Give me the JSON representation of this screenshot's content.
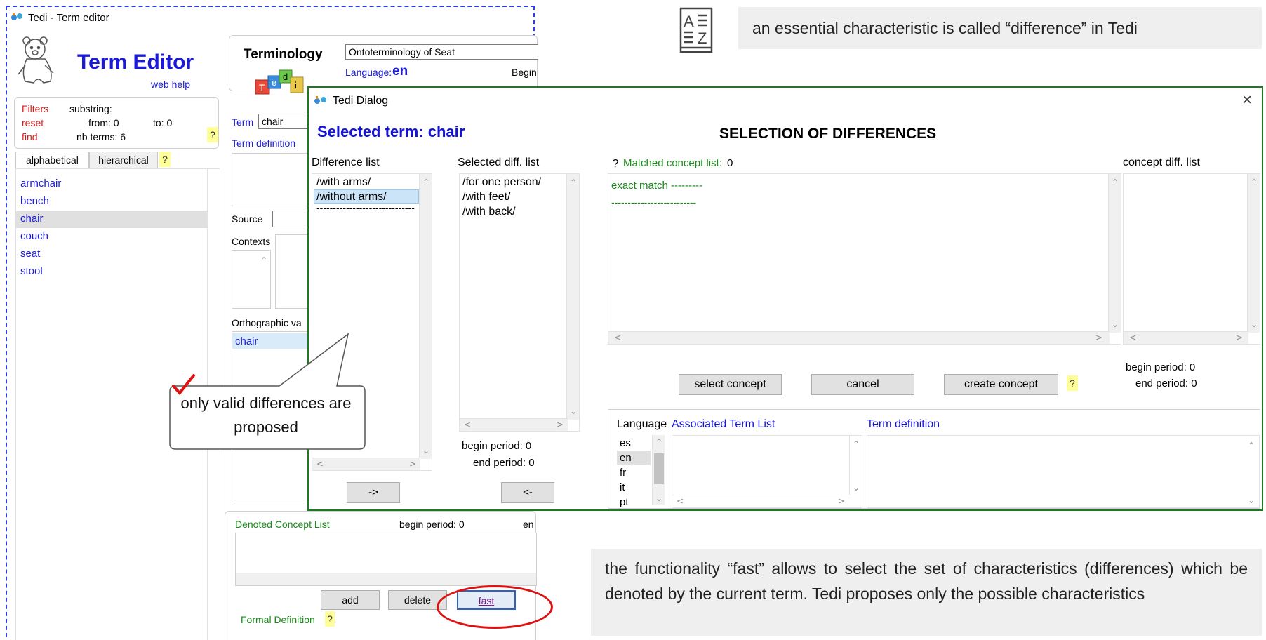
{
  "main_window": {
    "title": "Tedi - Term editor",
    "header_title": "Term Editor",
    "web_help": "web help",
    "filters": {
      "filters_label": "Filters",
      "reset_label": "reset",
      "find_label": "find",
      "substring_label": "substring:",
      "from_label": "from: 0",
      "to_label": "to: 0",
      "nb_terms_label": "nb terms: 6",
      "help": "?"
    },
    "tabs": [
      "alphabetical",
      "hierarchical"
    ],
    "tabs_help": "?",
    "term_list": [
      "armchair",
      "bench",
      "chair",
      "couch",
      "seat",
      "stool"
    ],
    "selected_term_index": 2,
    "terminology_label": "Terminology",
    "terminology_value": "Ontoterminology of Seat",
    "language_label": "Language:",
    "language_value": "en",
    "begin_label": "Begin",
    "term_label": "Term",
    "term_value": "chair",
    "term_definition_label": "Term definition",
    "source_label": "Source",
    "contexts_label": "Contexts",
    "orthographic_label": "Orthographic va",
    "orthographic_item": "chair",
    "denoted_concept_label": "Denoted Concept List",
    "denoted_begin_period": "begin period: 0",
    "denoted_end_fragment": "en",
    "buttons": {
      "add": "add",
      "delete": "delete",
      "fast": "fast"
    },
    "formal_definition_label": "Formal Definition",
    "formal_help": "?",
    "logo_letters": [
      "T",
      "e",
      "d",
      "i"
    ]
  },
  "dialog": {
    "title": "Tedi Dialog",
    "close": "×",
    "selected_term": "Selected term: chair",
    "heading": "SELECTION OF DIFFERENCES",
    "difference_list_label": "Difference list",
    "difference_list": [
      "/with arms/",
      "/without arms/",
      "------------------------------"
    ],
    "difference_selected_index": 1,
    "selected_diff_label": "Selected diff. list",
    "selected_diff_list": [
      "/for one person/",
      "/with feet/",
      "/with back/"
    ],
    "selected_begin_period": "begin period: 0",
    "selected_end_period": "end period: 0",
    "matched_help": "?",
    "matched_label": "Matched concept list:",
    "matched_count": "0",
    "matched_items": [
      "exact match ---------",
      "--------------------------"
    ],
    "concept_diff_label": "concept diff. list",
    "concept_begin_period": "begin period: 0",
    "concept_end_period": "end period: 0",
    "buttons": {
      "select_concept": "select concept",
      "cancel": "cancel",
      "create_concept": "create concept",
      "help": "?",
      "move_right": "->",
      "move_left": "<-"
    },
    "language_label": "Language",
    "languages": [
      "es",
      "en",
      "fr",
      "it",
      "pt"
    ],
    "language_selected_index": 1,
    "associated_term_label": "Associated Term List",
    "term_definition_label": "Term definition"
  },
  "callouts": {
    "top_right": "an essential characteristic is called “difference” in Tedi",
    "speech_bubble": "only valid differences are proposed",
    "bottom_right": "the functionality “fast” allows to select the set of characteristics (differences) which be denoted by the current term. Tedi proposes only the possible characteristics"
  },
  "colors": {
    "link_blue": "#1a1ad8",
    "link_red": "#d81a1a",
    "dialog_border": "#1d7a1d",
    "window_border": "#2b3fe0",
    "highlight_oval": "#e01010",
    "checkmark": "#e01010"
  },
  "icons": [
    "tedi-app-icon",
    "bear-mascot-icon",
    "tedi-blocks-logo",
    "dictionary-az-icon",
    "checkmark-icon",
    "close-icon"
  ]
}
